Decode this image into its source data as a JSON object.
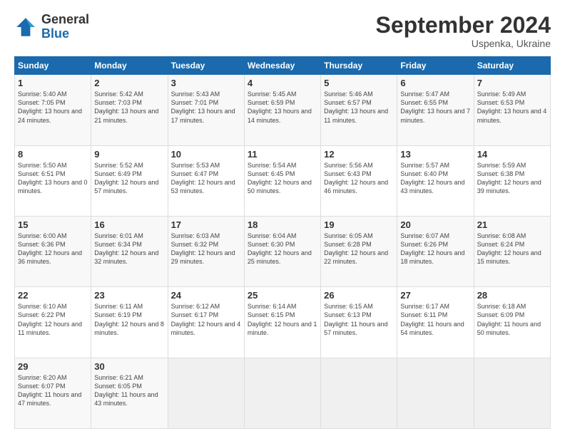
{
  "logo": {
    "general": "General",
    "blue": "Blue"
  },
  "header": {
    "title": "September 2024",
    "subtitle": "Uspenka, Ukraine"
  },
  "days_of_week": [
    "Sunday",
    "Monday",
    "Tuesday",
    "Wednesday",
    "Thursday",
    "Friday",
    "Saturday"
  ],
  "weeks": [
    [
      {
        "day": "1",
        "sunrise": "5:40 AM",
        "sunset": "7:05 PM",
        "daylight": "13 hours and 24 minutes."
      },
      {
        "day": "2",
        "sunrise": "5:42 AM",
        "sunset": "7:03 PM",
        "daylight": "13 hours and 21 minutes."
      },
      {
        "day": "3",
        "sunrise": "5:43 AM",
        "sunset": "7:01 PM",
        "daylight": "13 hours and 17 minutes."
      },
      {
        "day": "4",
        "sunrise": "5:45 AM",
        "sunset": "6:59 PM",
        "daylight": "13 hours and 14 minutes."
      },
      {
        "day": "5",
        "sunrise": "5:46 AM",
        "sunset": "6:57 PM",
        "daylight": "13 hours and 11 minutes."
      },
      {
        "day": "6",
        "sunrise": "5:47 AM",
        "sunset": "6:55 PM",
        "daylight": "13 hours and 7 minutes."
      },
      {
        "day": "7",
        "sunrise": "5:49 AM",
        "sunset": "6:53 PM",
        "daylight": "13 hours and 4 minutes."
      }
    ],
    [
      {
        "day": "8",
        "sunrise": "5:50 AM",
        "sunset": "6:51 PM",
        "daylight": "13 hours and 0 minutes."
      },
      {
        "day": "9",
        "sunrise": "5:52 AM",
        "sunset": "6:49 PM",
        "daylight": "12 hours and 57 minutes."
      },
      {
        "day": "10",
        "sunrise": "5:53 AM",
        "sunset": "6:47 PM",
        "daylight": "12 hours and 53 minutes."
      },
      {
        "day": "11",
        "sunrise": "5:54 AM",
        "sunset": "6:45 PM",
        "daylight": "12 hours and 50 minutes."
      },
      {
        "day": "12",
        "sunrise": "5:56 AM",
        "sunset": "6:43 PM",
        "daylight": "12 hours and 46 minutes."
      },
      {
        "day": "13",
        "sunrise": "5:57 AM",
        "sunset": "6:40 PM",
        "daylight": "12 hours and 43 minutes."
      },
      {
        "day": "14",
        "sunrise": "5:59 AM",
        "sunset": "6:38 PM",
        "daylight": "12 hours and 39 minutes."
      }
    ],
    [
      {
        "day": "15",
        "sunrise": "6:00 AM",
        "sunset": "6:36 PM",
        "daylight": "12 hours and 36 minutes."
      },
      {
        "day": "16",
        "sunrise": "6:01 AM",
        "sunset": "6:34 PM",
        "daylight": "12 hours and 32 minutes."
      },
      {
        "day": "17",
        "sunrise": "6:03 AM",
        "sunset": "6:32 PM",
        "daylight": "12 hours and 29 minutes."
      },
      {
        "day": "18",
        "sunrise": "6:04 AM",
        "sunset": "6:30 PM",
        "daylight": "12 hours and 25 minutes."
      },
      {
        "day": "19",
        "sunrise": "6:05 AM",
        "sunset": "6:28 PM",
        "daylight": "12 hours and 22 minutes."
      },
      {
        "day": "20",
        "sunrise": "6:07 AM",
        "sunset": "6:26 PM",
        "daylight": "12 hours and 18 minutes."
      },
      {
        "day": "21",
        "sunrise": "6:08 AM",
        "sunset": "6:24 PM",
        "daylight": "12 hours and 15 minutes."
      }
    ],
    [
      {
        "day": "22",
        "sunrise": "6:10 AM",
        "sunset": "6:22 PM",
        "daylight": "12 hours and 11 minutes."
      },
      {
        "day": "23",
        "sunrise": "6:11 AM",
        "sunset": "6:19 PM",
        "daylight": "12 hours and 8 minutes."
      },
      {
        "day": "24",
        "sunrise": "6:12 AM",
        "sunset": "6:17 PM",
        "daylight": "12 hours and 4 minutes."
      },
      {
        "day": "25",
        "sunrise": "6:14 AM",
        "sunset": "6:15 PM",
        "daylight": "12 hours and 1 minute."
      },
      {
        "day": "26",
        "sunrise": "6:15 AM",
        "sunset": "6:13 PM",
        "daylight": "11 hours and 57 minutes."
      },
      {
        "day": "27",
        "sunrise": "6:17 AM",
        "sunset": "6:11 PM",
        "daylight": "11 hours and 54 minutes."
      },
      {
        "day": "28",
        "sunrise": "6:18 AM",
        "sunset": "6:09 PM",
        "daylight": "11 hours and 50 minutes."
      }
    ],
    [
      {
        "day": "29",
        "sunrise": "6:20 AM",
        "sunset": "6:07 PM",
        "daylight": "11 hours and 47 minutes."
      },
      {
        "day": "30",
        "sunrise": "6:21 AM",
        "sunset": "6:05 PM",
        "daylight": "11 hours and 43 minutes."
      },
      {
        "day": "",
        "sunrise": "",
        "sunset": "",
        "daylight": ""
      },
      {
        "day": "",
        "sunrise": "",
        "sunset": "",
        "daylight": ""
      },
      {
        "day": "",
        "sunrise": "",
        "sunset": "",
        "daylight": ""
      },
      {
        "day": "",
        "sunrise": "",
        "sunset": "",
        "daylight": ""
      },
      {
        "day": "",
        "sunrise": "",
        "sunset": "",
        "daylight": ""
      }
    ]
  ]
}
